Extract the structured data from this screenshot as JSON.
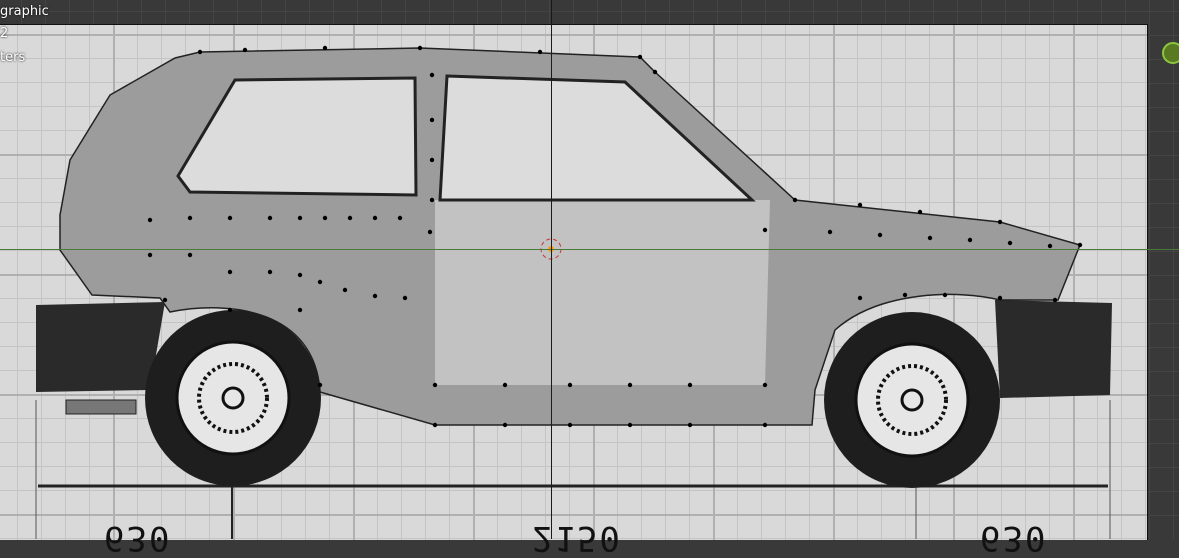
{
  "viewport": {
    "overlay": [
      "graphic",
      "2",
      "ters"
    ],
    "dimensions": [
      "630",
      "2150",
      "630"
    ],
    "colors": {
      "mesh": "#9c9c9c",
      "blueprint": "#d9d9d9",
      "background": "#393939",
      "gizmo": "#8cc63f"
    }
  }
}
